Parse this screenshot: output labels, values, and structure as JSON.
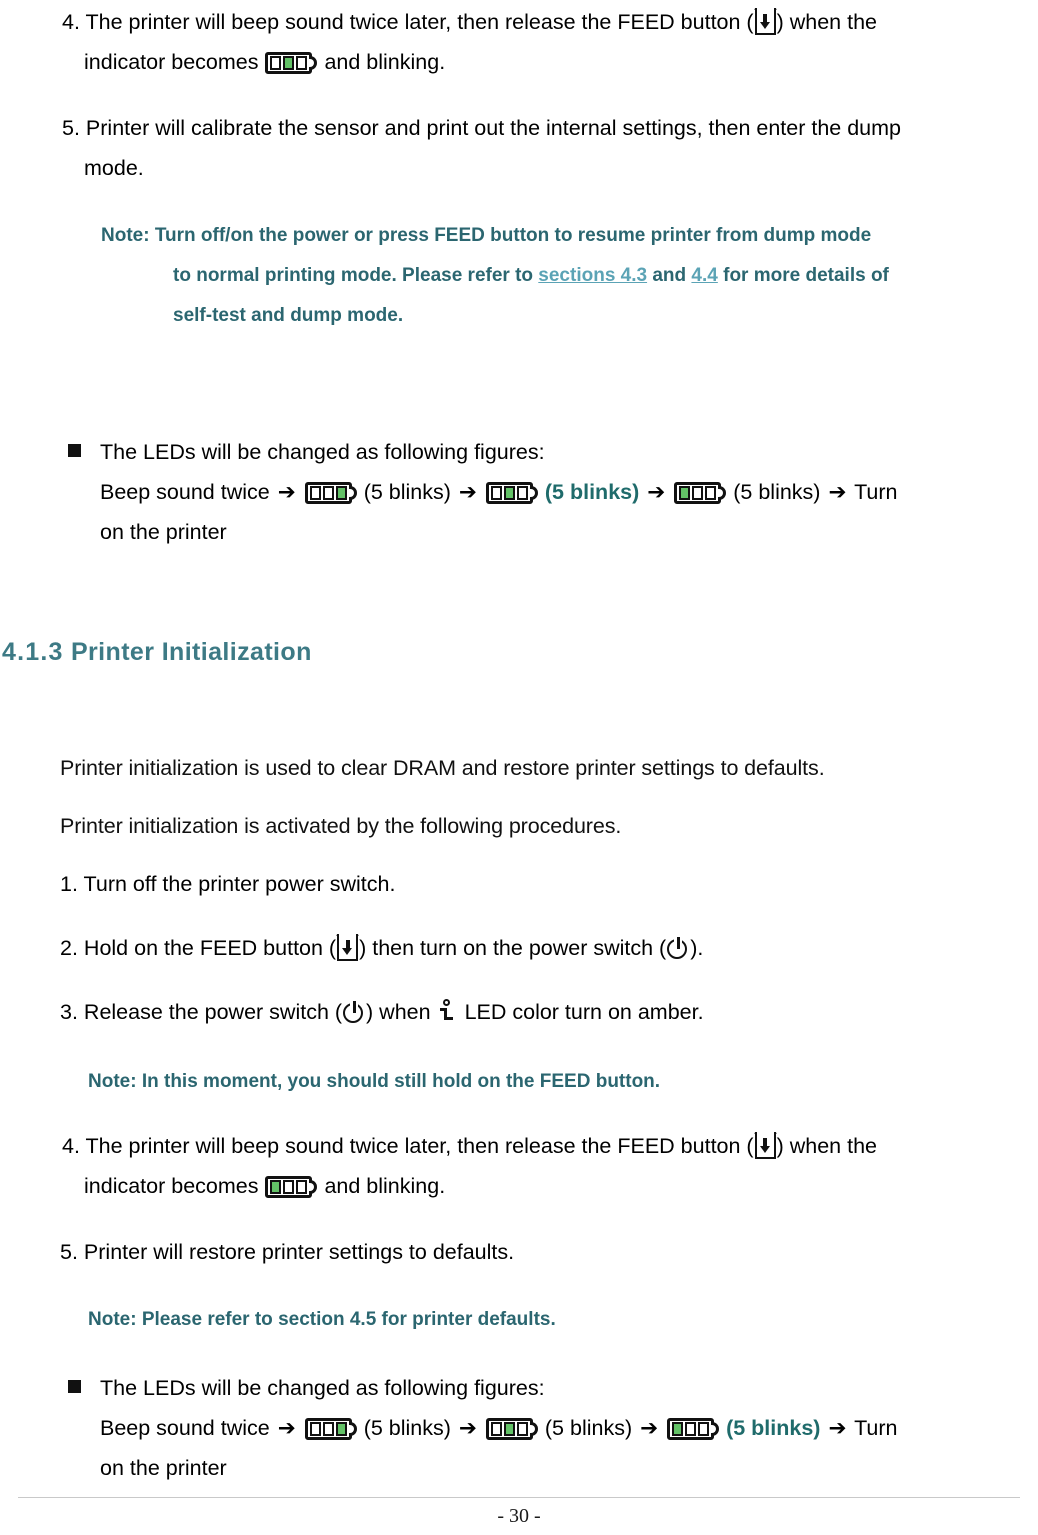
{
  "document": {
    "page_number": "- 30 -"
  },
  "top_section": {
    "step4": {
      "number": "4.",
      "text_part1": "The printer will beep sound twice later, then release the FEED button (",
      "text_part2": ") when the",
      "text_part3": "indicator becomes",
      "text_part4": "and blinking.",
      "feed_icon": "feed-button-icon",
      "led_icon": "led-indicator-icon"
    },
    "step5": {
      "number": "5.",
      "text": "Printer will calibrate the sensor and print out the internal settings, then enter the dump",
      "text_line2": "mode."
    },
    "note": {
      "line1": "Note: Turn off/on the power or press FEED button to resume printer from dump mode",
      "line2_a": "to normal printing mode. Please refer to ",
      "link1": "sections 4.3",
      "line2_b": " and ",
      "link2": "4.4",
      "line2_c": " for more details of",
      "line3": "self-test and dump mode."
    },
    "leds_bullet": {
      "heading": "The LEDs will be changed as following figures:",
      "seq_start": "Beep sound twice",
      "arrow": "➔",
      "blink1": "(5 blinks)",
      "blink2": "(5 blinks)",
      "blink3": "(5 blinks)",
      "seq_end": "Turn",
      "seq_end2": "on the printer",
      "led1_on": "right",
      "led2_on": "middle",
      "led3_on": "left",
      "highlighted_index": 2
    }
  },
  "section": {
    "number": "4.1.3",
    "title": "Printer Initialization"
  },
  "body": {
    "intro1": "Printer initialization is used to clear DRAM and restore printer settings to defaults.",
    "intro2": "Printer initialization is activated by the following procedures.",
    "step1": {
      "number": "1.",
      "text": "Turn off the printer power switch."
    },
    "step2": {
      "number": "2.",
      "text_a": "Hold on the FEED button (",
      "text_b": ") then turn on the power switch (",
      "text_c": ")."
    },
    "step3": {
      "number": "3.",
      "text_a": "Release the power switch (",
      "text_b": ") when",
      "text_c": "LED color turn on amber."
    },
    "note1": "Note: In this moment, you should still hold on the FEED button.",
    "step4": {
      "number": "4.",
      "text_part1": "The printer will beep sound twice later, then release the FEED button (",
      "text_part2": ") when the",
      "text_part3": "indicator becomes",
      "text_part4": "and blinking."
    },
    "step5": {
      "number": "5.",
      "text": "Printer will restore printer settings to defaults."
    },
    "note2": "Note: Please refer to section 4.5 for printer defaults.",
    "leds_bullet": {
      "heading": "The LEDs will be changed as following figures:",
      "seq_start": "Beep sound twice",
      "arrow": "➔",
      "blink1": "(5 blinks)",
      "blink2": "(5 blinks)",
      "blink3": "(5 blinks)",
      "seq_end": "Turn",
      "seq_end2": "on the printer",
      "led1_on": "right",
      "led2_on": "middle",
      "led3_on": "left",
      "highlighted_index": 3
    }
  },
  "colors": {
    "heading_teal": "#3d7a85",
    "note_teal": "#2b6670",
    "link_blue": "#5ba3b5",
    "led_green": "#63c267",
    "highlight_teal": "#1f6b6b"
  }
}
